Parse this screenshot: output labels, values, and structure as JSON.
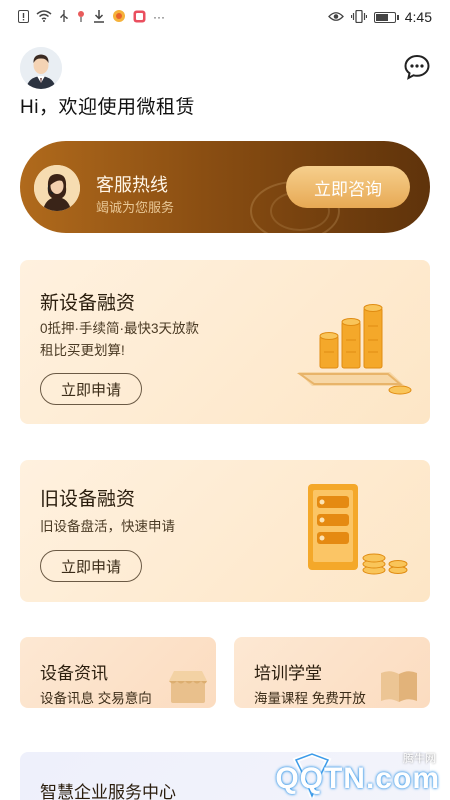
{
  "status_bar": {
    "left_icons": [
      "alert-icon",
      "wifi-icon",
      "usb-icon",
      "location-icon",
      "download-icon",
      "app-icon",
      "app2-icon",
      "more-icon"
    ],
    "more_symbol": "···",
    "right_icons": [
      "eye-icon",
      "vibrate-icon",
      "battery-icon"
    ],
    "time": "4:45"
  },
  "header": {
    "greeting": "Hi，欢迎使用微租赁"
  },
  "hotline": {
    "title": "客服热线",
    "subtitle": "竭诚为您服务",
    "button_label": "立即咨询"
  },
  "cards": {
    "new_equipment": {
      "title": "新设备融资",
      "desc_line1": "0抵押·手续简·最快3天放款",
      "desc_line2": "租比买更划算!",
      "button_label": "立即申请"
    },
    "used_equipment": {
      "title": "旧设备融资",
      "desc_line1": "旧设备盘活，快速申请",
      "button_label": "立即申请"
    },
    "equipment_news": {
      "title": "设备资讯",
      "desc": "设备讯息 交易意向"
    },
    "training": {
      "title": "培训学堂",
      "desc": "海量课程 免费开放"
    },
    "service_center": {
      "title": "智慧企业服务中心"
    }
  },
  "watermark": {
    "small": "腾牛网",
    "big": "QQTN.com"
  },
  "colors": {
    "hotline_gradient_start": "#b06a1c",
    "hotline_gradient_end": "#5f330b",
    "accent_gold": "#e7a954",
    "card_bg": "#fde6c6"
  }
}
